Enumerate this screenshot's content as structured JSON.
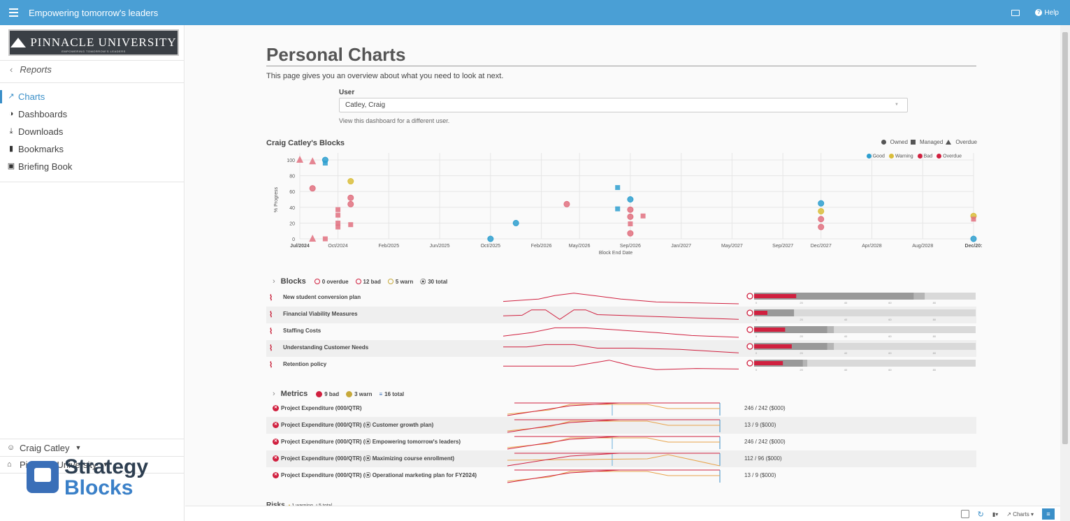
{
  "app": {
    "title": "Empowering tomorrow's leaders",
    "help_label": "Help"
  },
  "brand": {
    "logo_text": "PINNACLE UNIVERSITY",
    "logo_sub": "EMPOWERING TOMORROW'S LEADERS",
    "footer_top": "Strategy",
    "footer_bottom": "Blocks"
  },
  "sidebar": {
    "back_label": "Reports",
    "items": [
      {
        "label": "Charts",
        "icon": "chart-line-icon",
        "active": true
      },
      {
        "label": "Dashboards",
        "icon": "dashboard-icon"
      },
      {
        "label": "Downloads",
        "icon": "download-icon"
      },
      {
        "label": "Bookmarks",
        "icon": "bookmark-icon"
      },
      {
        "label": "Briefing Book",
        "icon": "briefcase-icon"
      }
    ],
    "user": "Craig Catley",
    "org": "Pinnacle University"
  },
  "page": {
    "title": "Personal Charts",
    "intro": "This page gives you an overview about what you need to look at next.",
    "user_label": "User",
    "user_value": "Catley, Craig",
    "user_help": "View this dashboard for a different user."
  },
  "blocks_chart": {
    "title": "Craig Catley's Blocks",
    "legend_shape": [
      "Owned",
      "Managed",
      "Overdue"
    ],
    "legend_status": [
      {
        "label": "Good",
        "color": "#2e9fcf"
      },
      {
        "label": "Warning",
        "color": "#d9bd3a"
      },
      {
        "label": "Bad",
        "color": "#d0203f"
      },
      {
        "label": "Overdue",
        "color": "#d0203f"
      }
    ],
    "ylabel": "% Progress",
    "xlabel": "Block End Date",
    "yticks": [
      "0",
      "20",
      "40",
      "60",
      "80",
      "100"
    ],
    "xticks": [
      "Jul/2024",
      "Oct/2024",
      "Feb/2025",
      "Jun/2025",
      "Oct/2025",
      "Feb/2026",
      "May/2026",
      "Sep/2026",
      "Jan/2027",
      "May/2027",
      "Sep/2027",
      "Dec/2027",
      "Apr/2028",
      "Aug/2028",
      "Dec/20:"
    ]
  },
  "chart_data": {
    "type": "scatter",
    "xlabel": "Block End Date",
    "ylabel": "% Progress",
    "ylim": [
      0,
      100
    ],
    "points": [
      {
        "x": "Jul/2024",
        "y": 100,
        "shape": "triangle",
        "status": "Overdue"
      },
      {
        "x": "Aug/2024",
        "y": 98,
        "shape": "triangle",
        "status": "Overdue"
      },
      {
        "x": "Sep/2024",
        "y": 100,
        "shape": "circle",
        "status": "Good"
      },
      {
        "x": "Sep/2024",
        "y": 96,
        "shape": "square",
        "status": "Good"
      },
      {
        "x": "Aug/2024",
        "y": 64,
        "shape": "circle",
        "status": "Bad"
      },
      {
        "x": "Oct/2024",
        "y": 37,
        "shape": "square",
        "status": "Bad"
      },
      {
        "x": "Oct/2024",
        "y": 30,
        "shape": "square",
        "status": "Bad"
      },
      {
        "x": "Oct/2024",
        "y": 20,
        "shape": "square",
        "status": "Bad"
      },
      {
        "x": "Oct/2024",
        "y": 15,
        "shape": "square",
        "status": "Bad"
      },
      {
        "x": "Nov/2024",
        "y": 73,
        "shape": "circle",
        "status": "Warning"
      },
      {
        "x": "Nov/2024",
        "y": 52,
        "shape": "circle",
        "status": "Bad"
      },
      {
        "x": "Nov/2024",
        "y": 44,
        "shape": "circle",
        "status": "Bad"
      },
      {
        "x": "Nov/2024",
        "y": 18,
        "shape": "square",
        "status": "Bad"
      },
      {
        "x": "Aug/2024",
        "y": 0,
        "shape": "triangle",
        "status": "Overdue"
      },
      {
        "x": "Sep/2024",
        "y": 0,
        "shape": "square",
        "status": "Bad"
      },
      {
        "x": "Oct/2025",
        "y": 0,
        "shape": "circle",
        "status": "Good"
      },
      {
        "x": "Dec/2025",
        "y": 20,
        "shape": "circle",
        "status": "Good"
      },
      {
        "x": "Apr/2026",
        "y": 44,
        "shape": "circle",
        "status": "Bad"
      },
      {
        "x": "Aug/2026",
        "y": 65,
        "shape": "square",
        "status": "Good"
      },
      {
        "x": "Aug/2026",
        "y": 38,
        "shape": "square",
        "status": "Good"
      },
      {
        "x": "Sep/2026",
        "y": 50,
        "shape": "circle",
        "status": "Good"
      },
      {
        "x": "Sep/2026",
        "y": 37,
        "shape": "circle",
        "status": "Bad"
      },
      {
        "x": "Sep/2026",
        "y": 28,
        "shape": "circle",
        "status": "Bad"
      },
      {
        "x": "Sep/2026",
        "y": 19,
        "shape": "square",
        "status": "Bad"
      },
      {
        "x": "Sep/2026",
        "y": 7,
        "shape": "circle",
        "status": "Bad"
      },
      {
        "x": "Oct/2026",
        "y": 29,
        "shape": "square",
        "status": "Bad"
      },
      {
        "x": "Dec/2027",
        "y": 45,
        "shape": "circle",
        "status": "Good"
      },
      {
        "x": "Dec/2027",
        "y": 35,
        "shape": "circle",
        "status": "Warning"
      },
      {
        "x": "Dec/2027",
        "y": 25,
        "shape": "circle",
        "status": "Bad"
      },
      {
        "x": "Dec/2027",
        "y": 15,
        "shape": "circle",
        "status": "Bad"
      },
      {
        "x": "Dec/2028",
        "y": 29,
        "shape": "circle",
        "status": "Warning"
      },
      {
        "x": "Dec/2028",
        "y": 25,
        "shape": "square",
        "status": "Bad"
      },
      {
        "x": "Dec/2028",
        "y": 0,
        "shape": "circle",
        "status": "Good"
      }
    ]
  },
  "blocks": {
    "label": "Blocks",
    "stats": [
      {
        "label": "0 overdue",
        "color": "#d0203f"
      },
      {
        "label": "12 bad",
        "color": "#d0203f"
      },
      {
        "label": "5 warn",
        "color": "#c7a93a"
      },
      {
        "label": "30 total",
        "color": "#555"
      }
    ],
    "rows": [
      {
        "name": "New student conversion plan",
        "progress": 19
      },
      {
        "name": "Financial Viability Measures",
        "progress": 6
      },
      {
        "name": "Staffing Costs",
        "progress": 14
      },
      {
        "name": "Understanding Customer Needs",
        "progress": 17
      },
      {
        "name": "Retention policy",
        "progress": 13
      }
    ],
    "axis_ticks": [
      "0",
      "20",
      "40",
      "60",
      "80"
    ]
  },
  "metrics": {
    "label": "Metrics",
    "stats": [
      {
        "label": "9 bad",
        "color": "#d0203f"
      },
      {
        "label": "3 warn",
        "color": "#c7a93a"
      },
      {
        "label": "16 total",
        "color": "#3a6fb8"
      }
    ],
    "rows": [
      {
        "name": "Project Expenditure (000/QTR)",
        "value": "246 / 242 ($000)"
      },
      {
        "name": "Project Expenditure (000/QTR) (⦿ Customer growth plan)",
        "value": "13 / 9 ($000)"
      },
      {
        "name": "Project Expenditure (000/QTR) (⦿ Empowering tomorrow's leaders)",
        "value": "246 / 242 ($000)"
      },
      {
        "name": "Project Expenditure (000/QTR) (⦿ Maximizing course enrollment)",
        "value": "112 / 96 ($000)"
      },
      {
        "name": "Project Expenditure (000/QTR) (⦿ Operational marketing plan for FY2024)",
        "value": "13 / 9 ($000)"
      }
    ]
  },
  "risks": {
    "label": "Risks",
    "stats": [
      "1 warning",
      "5 total"
    ]
  },
  "toolbar": {
    "charts_label": "Charts"
  }
}
